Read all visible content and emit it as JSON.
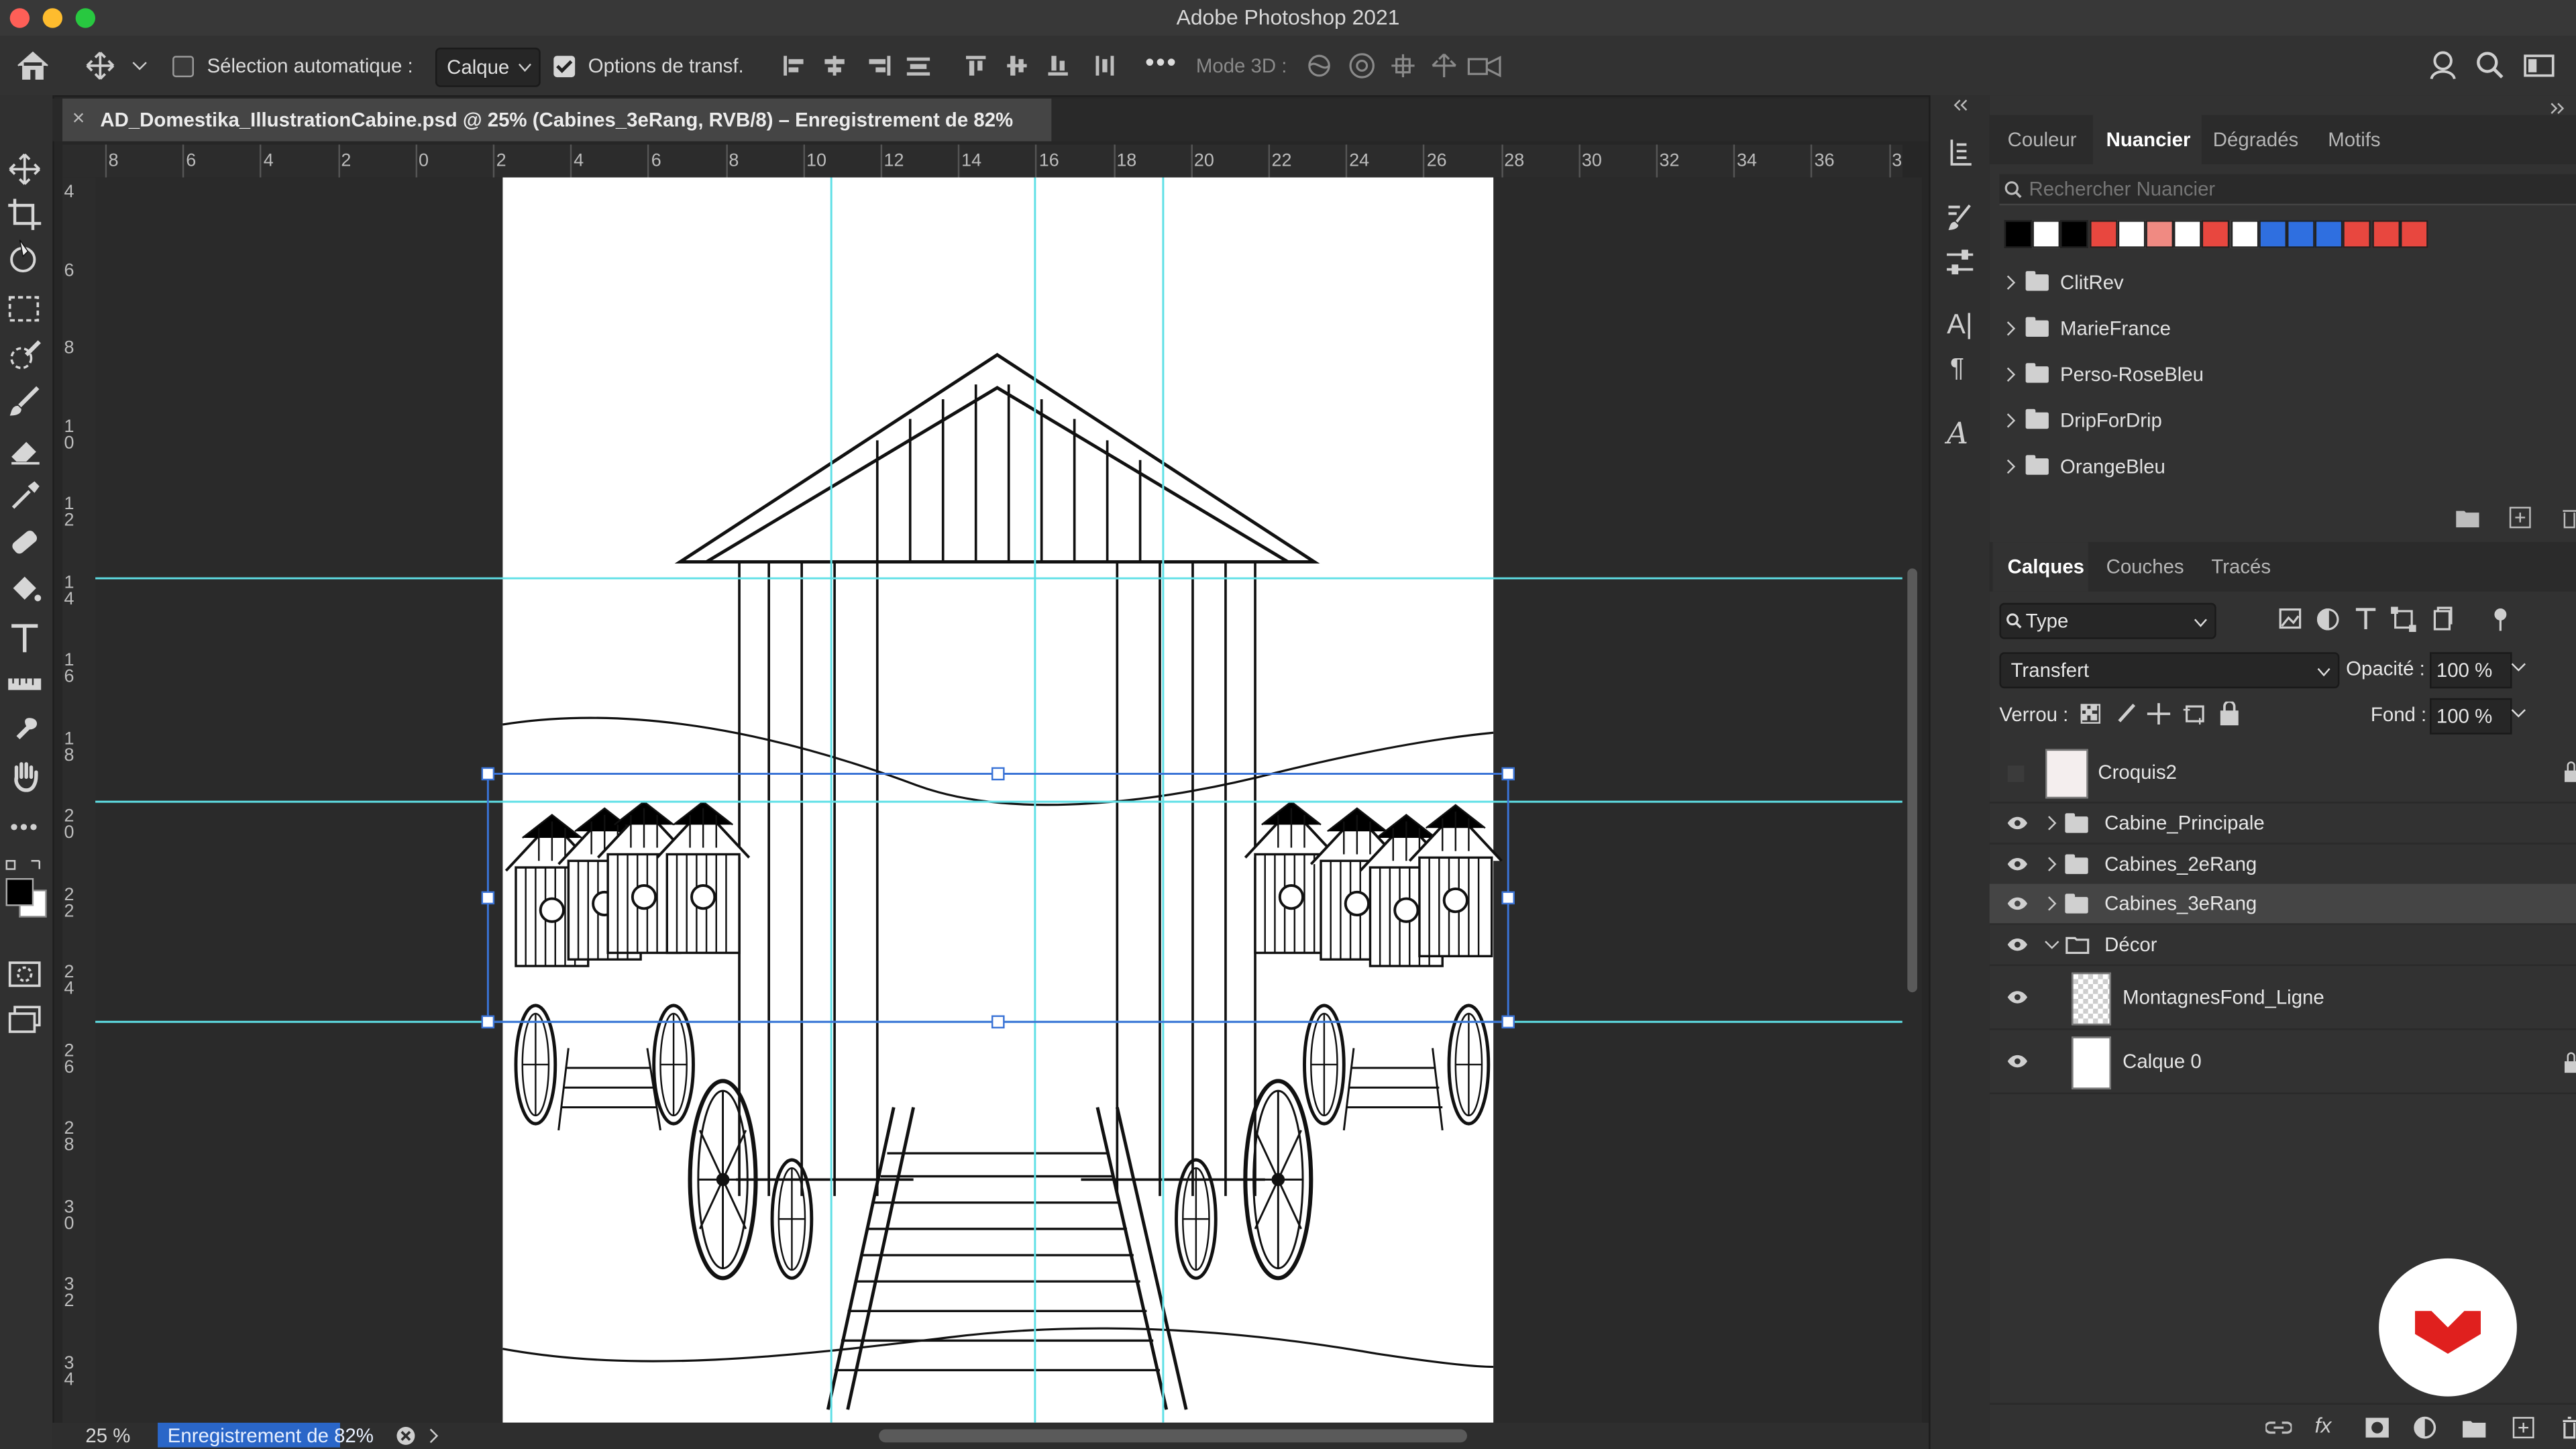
{
  "app": {
    "title": "Adobe Photoshop 2021"
  },
  "options_bar": {
    "auto_select_label": "Sélection automatique :",
    "auto_select_value": "Calque",
    "transform_label": "Options de transf.",
    "mode3d_label": "Mode 3D :"
  },
  "document": {
    "tab_title": "AD_Domestika_IllustrationCabine.psd @ 25% (Cabines_3eRang, RVB/8) – Enregistrement de 82%",
    "close_glyph": "×"
  },
  "rulers": {
    "horizontal": [
      "8",
      "6",
      "4",
      "2",
      "0",
      "2",
      "4",
      "6",
      "8",
      "10",
      "12",
      "14",
      "16",
      "18",
      "20",
      "22",
      "24",
      "26",
      "28",
      "30",
      "32",
      "34",
      "36",
      "3"
    ],
    "vertical": [
      "4",
      "6",
      "8",
      "1\n0",
      "1\n2",
      "1\n4",
      "1\n6",
      "1\n8",
      "2\n0",
      "2\n2",
      "2\n4",
      "2\n6",
      "2\n8",
      "3\n0",
      "3\n2",
      "3\n4"
    ]
  },
  "status": {
    "zoom": "25 %",
    "progress_text": "Enregistrement de 82%",
    "progress": 0.82
  },
  "swatches_panel": {
    "tabs": [
      "Couleur",
      "Nuancier",
      "Dégradés",
      "Motifs"
    ],
    "active_tab": "Nuancier",
    "search_placeholder": "Rechercher Nuancier",
    "colors": [
      "#000000",
      "#ffffff",
      "#000000",
      "#e8473f",
      "#ffffff",
      "#f08a82",
      "#ffffff",
      "#e8473f",
      "#ffffff",
      "#2f6fe0",
      "#2f6fe0",
      "#2f6fe0",
      "#e8473f",
      "#e8473f",
      "#e8473f"
    ],
    "groups": [
      "ClitRev",
      "MarieFrance",
      "Perso-RoseBleu",
      "DripForDrip",
      "OrangeBleu"
    ]
  },
  "layers_panel": {
    "tabs": [
      "Calques",
      "Couches",
      "Tracés"
    ],
    "active_tab": "Calques",
    "filter_label": "Type",
    "blend_mode": "Transfert",
    "opacity_label": "Opacité :",
    "opacity_value": "100 %",
    "lock_label": "Verrou :",
    "fill_label": "Fond :",
    "fill_value": "100 %",
    "layers": [
      {
        "name": "Croquis2",
        "kind": "layer",
        "visible": false
      },
      {
        "name": "Cabine_Principale",
        "kind": "group",
        "visible": true
      },
      {
        "name": "Cabines_2eRang",
        "kind": "group",
        "visible": true
      },
      {
        "name": "Cabines_3eRang",
        "kind": "group",
        "visible": true,
        "selected": true
      },
      {
        "name": "Décor",
        "kind": "group",
        "visible": true,
        "expanded": true
      },
      {
        "name": "MontagnesFond_Ligne",
        "kind": "layer",
        "visible": true
      },
      {
        "name": "Calque 0",
        "kind": "layer",
        "visible": true
      }
    ]
  },
  "colors": {
    "guide": "#5fe0e6",
    "selection": "#2f6fe0",
    "accent_logo": "#e0201e"
  }
}
